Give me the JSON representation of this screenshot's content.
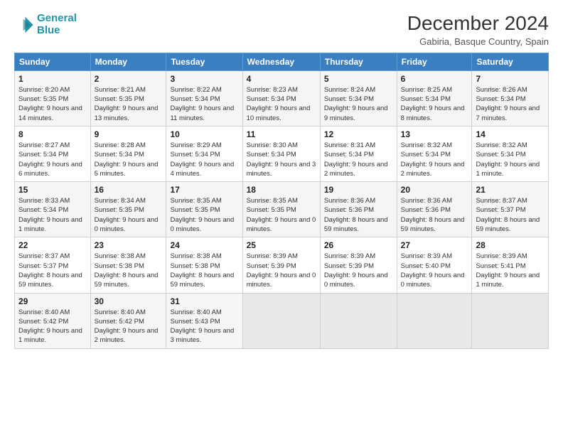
{
  "header": {
    "logo_line1": "General",
    "logo_line2": "Blue",
    "main_title": "December 2024",
    "subtitle": "Gabiria, Basque Country, Spain"
  },
  "days_of_week": [
    "Sunday",
    "Monday",
    "Tuesday",
    "Wednesday",
    "Thursday",
    "Friday",
    "Saturday"
  ],
  "weeks": [
    [
      {
        "day": "1",
        "sunrise": "8:20 AM",
        "sunset": "5:35 PM",
        "daylight": "9 hours and 14 minutes."
      },
      {
        "day": "2",
        "sunrise": "8:21 AM",
        "sunset": "5:35 PM",
        "daylight": "9 hours and 13 minutes."
      },
      {
        "day": "3",
        "sunrise": "8:22 AM",
        "sunset": "5:34 PM",
        "daylight": "9 hours and 11 minutes."
      },
      {
        "day": "4",
        "sunrise": "8:23 AM",
        "sunset": "5:34 PM",
        "daylight": "9 hours and 10 minutes."
      },
      {
        "day": "5",
        "sunrise": "8:24 AM",
        "sunset": "5:34 PM",
        "daylight": "9 hours and 9 minutes."
      },
      {
        "day": "6",
        "sunrise": "8:25 AM",
        "sunset": "5:34 PM",
        "daylight": "9 hours and 8 minutes."
      },
      {
        "day": "7",
        "sunrise": "8:26 AM",
        "sunset": "5:34 PM",
        "daylight": "9 hours and 7 minutes."
      }
    ],
    [
      {
        "day": "8",
        "sunrise": "8:27 AM",
        "sunset": "5:34 PM",
        "daylight": "9 hours and 6 minutes."
      },
      {
        "day": "9",
        "sunrise": "8:28 AM",
        "sunset": "5:34 PM",
        "daylight": "9 hours and 5 minutes."
      },
      {
        "day": "10",
        "sunrise": "8:29 AM",
        "sunset": "5:34 PM",
        "daylight": "9 hours and 4 minutes."
      },
      {
        "day": "11",
        "sunrise": "8:30 AM",
        "sunset": "5:34 PM",
        "daylight": "9 hours and 3 minutes."
      },
      {
        "day": "12",
        "sunrise": "8:31 AM",
        "sunset": "5:34 PM",
        "daylight": "9 hours and 2 minutes."
      },
      {
        "day": "13",
        "sunrise": "8:32 AM",
        "sunset": "5:34 PM",
        "daylight": "9 hours and 2 minutes."
      },
      {
        "day": "14",
        "sunrise": "8:32 AM",
        "sunset": "5:34 PM",
        "daylight": "9 hours and 1 minute."
      }
    ],
    [
      {
        "day": "15",
        "sunrise": "8:33 AM",
        "sunset": "5:34 PM",
        "daylight": "9 hours and 1 minute."
      },
      {
        "day": "16",
        "sunrise": "8:34 AM",
        "sunset": "5:35 PM",
        "daylight": "9 hours and 0 minutes."
      },
      {
        "day": "17",
        "sunrise": "8:35 AM",
        "sunset": "5:35 PM",
        "daylight": "9 hours and 0 minutes."
      },
      {
        "day": "18",
        "sunrise": "8:35 AM",
        "sunset": "5:35 PM",
        "daylight": "9 hours and 0 minutes."
      },
      {
        "day": "19",
        "sunrise": "8:36 AM",
        "sunset": "5:36 PM",
        "daylight": "8 hours and 59 minutes."
      },
      {
        "day": "20",
        "sunrise": "8:36 AM",
        "sunset": "5:36 PM",
        "daylight": "8 hours and 59 minutes."
      },
      {
        "day": "21",
        "sunrise": "8:37 AM",
        "sunset": "5:37 PM",
        "daylight": "8 hours and 59 minutes."
      }
    ],
    [
      {
        "day": "22",
        "sunrise": "8:37 AM",
        "sunset": "5:37 PM",
        "daylight": "8 hours and 59 minutes."
      },
      {
        "day": "23",
        "sunrise": "8:38 AM",
        "sunset": "5:38 PM",
        "daylight": "8 hours and 59 minutes."
      },
      {
        "day": "24",
        "sunrise": "8:38 AM",
        "sunset": "5:38 PM",
        "daylight": "8 hours and 59 minutes."
      },
      {
        "day": "25",
        "sunrise": "8:39 AM",
        "sunset": "5:39 PM",
        "daylight": "9 hours and 0 minutes."
      },
      {
        "day": "26",
        "sunrise": "8:39 AM",
        "sunset": "5:39 PM",
        "daylight": "9 hours and 0 minutes."
      },
      {
        "day": "27",
        "sunrise": "8:39 AM",
        "sunset": "5:40 PM",
        "daylight": "9 hours and 0 minutes."
      },
      {
        "day": "28",
        "sunrise": "8:39 AM",
        "sunset": "5:41 PM",
        "daylight": "9 hours and 1 minute."
      }
    ],
    [
      {
        "day": "29",
        "sunrise": "8:40 AM",
        "sunset": "5:42 PM",
        "daylight": "9 hours and 1 minute."
      },
      {
        "day": "30",
        "sunrise": "8:40 AM",
        "sunset": "5:42 PM",
        "daylight": "9 hours and 2 minutes."
      },
      {
        "day": "31",
        "sunrise": "8:40 AM",
        "sunset": "5:43 PM",
        "daylight": "9 hours and 3 minutes."
      },
      null,
      null,
      null,
      null
    ]
  ]
}
